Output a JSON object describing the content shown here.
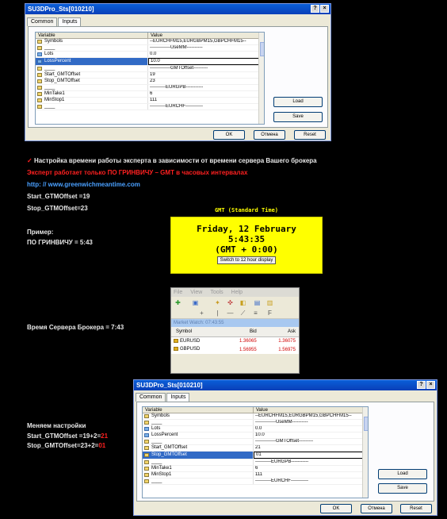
{
  "dialog1": {
    "title": "SU3DPro_Sts[010210]",
    "tabs": [
      "Common",
      "Inputs"
    ],
    "columns": [
      "Variable",
      "Value"
    ],
    "rows": [
      {
        "var": "Symbols",
        "val": "--EURCHFM15,EURGBPM15,GBPCHFM15--"
      },
      {
        "var": "____",
        "val": "-------------UseMM----------"
      },
      {
        "var": "Lots",
        "val": "0.0"
      },
      {
        "var": "LossPercent",
        "val": "10.0"
      },
      {
        "var": "____",
        "val": "-------------GMTOffset---------"
      },
      {
        "var": "Start_GMTOffset",
        "val": "19"
      },
      {
        "var": "Stop_GMTOffset",
        "val": "23"
      },
      {
        "var": "____",
        "val": "----------EURGPB-----------"
      },
      {
        "var": "MinTake1",
        "val": "6"
      },
      {
        "var": "MinStop1",
        "val": "111"
      },
      {
        "var": "____",
        "val": "----------EURCHF-----------"
      }
    ],
    "buttons": {
      "load": "Load",
      "save": "Save",
      "ok": "OK",
      "cancel": "Отмена",
      "reset": "Reset"
    }
  },
  "notes": {
    "check": "✓",
    "heading": "Настройка времени работы эксперта в зависимости от времени сервера Вашего брокера",
    "warning": "Эксперт работает только ПО ГРИНВИЧУ – GMT в часовых интервалах",
    "url": "http: // www.greenwichmeantime.com",
    "start": "Start_GTMOffset =19",
    "stop": "Stop_GTMOffset=23",
    "example": "Пример:",
    "gmt_now": "ПО ГРИНВИЧУ = 5:43",
    "server": "Время Сервера Брокера = 7:43",
    "change": "Меняем настройки",
    "start2_a": "Start_GTMOffset =19+2=",
    "start2_b": "21",
    "stop2_a": "Stop_GMTOffset=23+2=",
    "stop2_b": "01"
  },
  "gmt": {
    "title": "GMT (Standard Time)",
    "date": "Friday, 12 February",
    "time": "5:43:35",
    "zone": "(GMT + 0:00)",
    "button": "Switch to 12 hour display"
  },
  "market_watch": {
    "menu": [
      "File",
      "View",
      "Tools",
      "Help"
    ],
    "title": "Market Watch: 07:43:55",
    "columns": [
      "Symbol",
      "Bid",
      "Ask"
    ],
    "rows": [
      {
        "symbol": "EURUSD",
        "bid": "1.36065",
        "ask": "1.36075"
      },
      {
        "symbol": "GBPUSD",
        "bid": "1.56955",
        "ask": "1.56975"
      }
    ]
  },
  "dialog2": {
    "title": "SU3DPro_Sts[010210]",
    "tabs": [
      "Common",
      "Inputs"
    ],
    "columns": [
      "Variable",
      "Value"
    ],
    "rows": [
      {
        "var": "Symbols",
        "val": "--EURCHFM15,EURGBPM15,GBPCHFM15--"
      },
      {
        "var": "____",
        "val": "-------------UseMM----------"
      },
      {
        "var": "Lots",
        "val": "0.0"
      },
      {
        "var": "LossPercent",
        "val": "10.0"
      },
      {
        "var": "____",
        "val": "-------------GMTOffset---------"
      },
      {
        "var": "Start_GMTOffset",
        "val": "21"
      },
      {
        "var": "Stop_GMTOffset",
        "val": "01"
      },
      {
        "var": "____",
        "val": "----------EURGPB-----------"
      },
      {
        "var": "MinTake1",
        "val": "6"
      },
      {
        "var": "MinStop1",
        "val": "111"
      },
      {
        "var": "____",
        "val": "----------EURCHF-----------"
      }
    ],
    "buttons": {
      "load": "Load",
      "save": "Save",
      "ok": "OK",
      "cancel": "Отмена",
      "reset": "Reset"
    }
  },
  "colors": {
    "accent_red": "#ff2020",
    "link_blue": "#4aa0ff",
    "gmt_yellow": "#ffff00",
    "selection": "#316ac5"
  }
}
